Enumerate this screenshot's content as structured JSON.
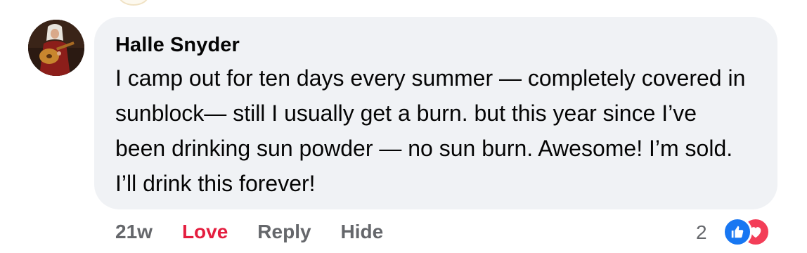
{
  "comment": {
    "author": "Halle Snyder",
    "text": "I camp out for ten days every summer — completely covered in sunblock— still I usually get a burn. but this year since I’ve been drinking sun powder — no sun burn. Awesome! I’m sold. I’ll drink this forever!",
    "actions": {
      "time": "21w",
      "love": "Love",
      "reply": "Reply",
      "hide": "Hide"
    },
    "reactions": {
      "count": "2",
      "types": [
        "like-icon",
        "love-icon"
      ]
    }
  },
  "colors": {
    "bubble_bg": "#f0f2f5",
    "love_label": "#e41e3f",
    "like_icon": "#1877f2",
    "love_icon": "#f33e58",
    "secondary_text": "#65676b"
  }
}
